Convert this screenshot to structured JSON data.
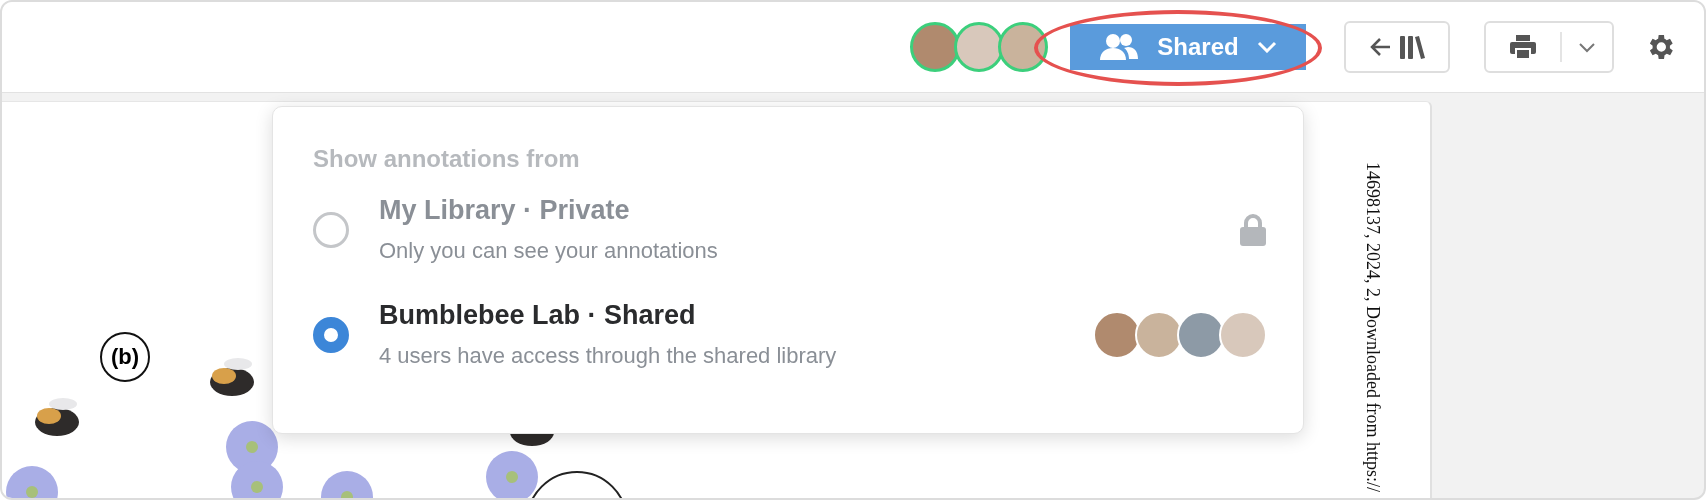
{
  "toolbar": {
    "collaborators": [
      {
        "kind": "photo"
      },
      {
        "kind": "photo"
      },
      {
        "kind": "photo"
      }
    ],
    "share_button": {
      "label": "Shared",
      "highlighted": true
    }
  },
  "annotations_menu": {
    "heading": "Show annotations from",
    "options": [
      {
        "kind": "private",
        "title": "My Library · Private",
        "subtitle": "Only you can see your annotations",
        "selected": false
      },
      {
        "kind": "shared",
        "title": "Bumblebee Lab · Shared",
        "subtitle": "4 users have access through the shared library",
        "selected": true,
        "members": [
          {
            "kind": "photo"
          },
          {
            "kind": "photo"
          },
          {
            "kind": "photo"
          },
          {
            "kind": "photo"
          }
        ]
      }
    ]
  },
  "document": {
    "figure_label": "(b)",
    "margin_note": "14698137, 2024, 2, Downloaded from https://"
  }
}
